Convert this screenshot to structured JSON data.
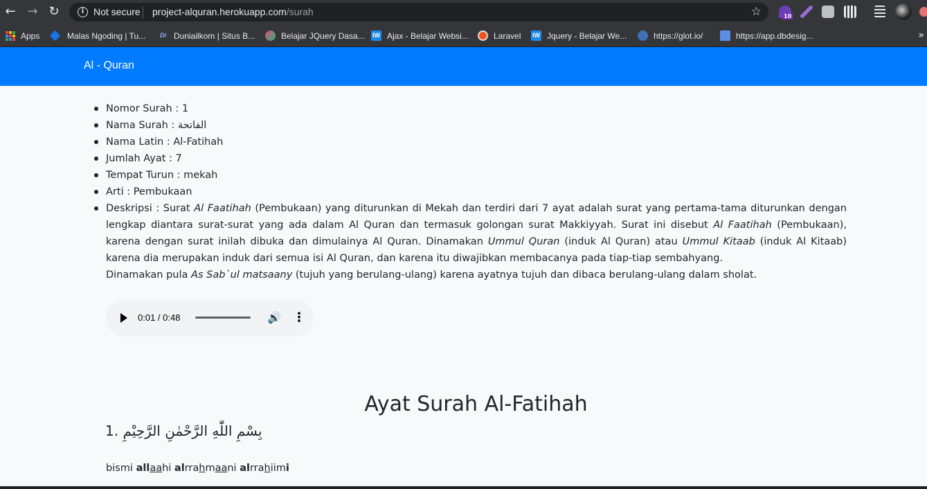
{
  "browser": {
    "security_label": "Not secure",
    "url_host": "project-alquran.herokuapp.com",
    "url_path": "/surah",
    "extension_badge": "10"
  },
  "bookmarks": [
    {
      "label": "Apps",
      "icon": "apps-grid-icon"
    },
    {
      "label": "Malas Ngoding | Tu...",
      "icon": "code-icon"
    },
    {
      "label": "Duniailkom | Situs B...",
      "icon": "di-icon"
    },
    {
      "label": "Belajar JQuery Dasa...",
      "icon": "leaf-icon"
    },
    {
      "label": "Ajax - Belajar Websi...",
      "icon": "iw-icon"
    },
    {
      "label": "Laravel",
      "icon": "laravel-icon"
    },
    {
      "label": "Jquery - Belajar We...",
      "icon": "iw-icon"
    },
    {
      "label": "https://glot.io/",
      "icon": "glot-icon"
    },
    {
      "label": "https://app.dbdesig...",
      "icon": "db-icon"
    }
  ],
  "navbar": {
    "brand": "Al - Quran"
  },
  "surah": {
    "nomor": "Nomor Surah : 1",
    "nama": "Nama Surah : الفاتحة",
    "nama_latin": "Nama Latin : Al-Fatihah",
    "jumlah_ayat": "Jumlah Ayat : 7",
    "tempat_turun": "Tempat Turun : mekah",
    "arti": "Arti : Pembukaan",
    "deskripsi_prefix": "Deskripsi : Surat ",
    "d_em1": "Al Faatihah",
    "d_t1": " (Pembukaan) yang diturunkan di Mekah dan terdiri dari 7 ayat adalah surat yang pertama-tama diturunkan dengan lengkap diantara surat-surat yang ada dalam Al Quran dan termasuk golongan surat Makkiyyah. Surat ini disebut ",
    "d_em2": "Al Faatihah",
    "d_t2": " (Pembukaan), karena dengan surat inilah dibuka dan dimulainya Al Quran. Dinamakan ",
    "d_em3": "Ummul Quran",
    "d_t3": " (induk Al Quran) atau ",
    "d_em4": "Ummul Kitaab",
    "d_t4": " (induk Al Kitaab) karena dia merupakan induk dari semua isi Al Quran, dan karena itu diwajibkan membacanya pada tiap-tiap sembahyang.",
    "d_t5": "Dinamakan pula ",
    "d_em5": "As Sab`ul matsaany",
    "d_t6": " (tujuh yang berulang-ulang) karena ayatnya tujuh dan dibaca berulang-ulang dalam sholat."
  },
  "audio": {
    "time": "0:01 / 0:48",
    "progress_fraction": 0.02
  },
  "ayat": {
    "title": "Ayat Surah Al-Fatihah",
    "item_1_arab": "1. بِسْمِ اللّٰهِ الرَّحْمٰنِ الرَّحِيْمِ",
    "latin_parts": [
      "bismi ",
      "al",
      "l",
      "aa",
      "hi ",
      "al",
      "rra",
      "h",
      "m",
      "aa",
      "ni ",
      "al",
      "rra",
      "h",
      "iim",
      "i"
    ]
  },
  "colors": {
    "navbar": "#007bff",
    "page_bg": "#f8f9fa",
    "text": "#212529"
  }
}
